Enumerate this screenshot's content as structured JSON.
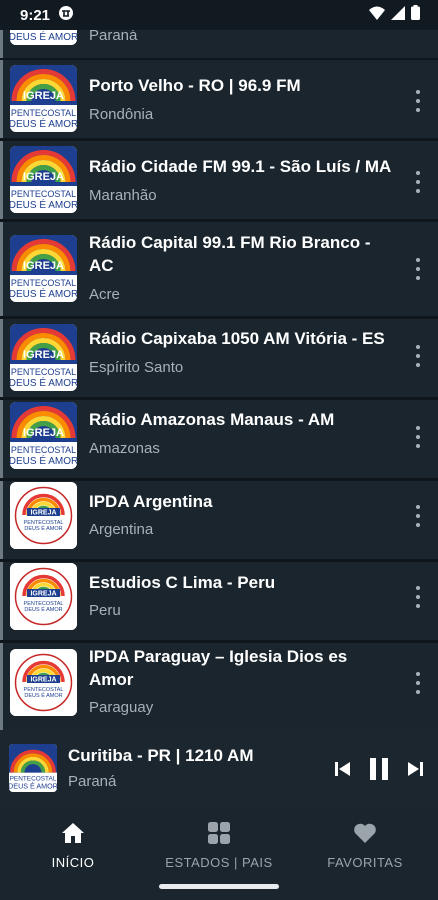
{
  "status_bar": {
    "time": "9:21"
  },
  "logo": {
    "line1": "IGREJA",
    "line2": "PENTECOSTAL",
    "line3": "DEUS É AMOR",
    "alt_line1": "IGREJA"
  },
  "stations": [
    {
      "title": "",
      "subtitle": "Paraná",
      "logo": "ipda-blue"
    },
    {
      "title": "Porto Velho - RO | 96.9 FM",
      "subtitle": "Rondônia",
      "logo": "ipda-blue"
    },
    {
      "title": "Rádio Cidade FM 99.1 - São Luís / MA",
      "subtitle": "Maranhão",
      "logo": "ipda-blue"
    },
    {
      "title": "Rádio Capital 99.1 FM Rio Branco - AC",
      "subtitle": "Acre",
      "logo": "ipda-blue"
    },
    {
      "title": "Rádio Capixaba 1050 AM Vitória - ES",
      "subtitle": "Espírito Santo",
      "logo": "ipda-blue"
    },
    {
      "title": "Rádio Amazonas Manaus - AM",
      "subtitle": "Amazonas",
      "logo": "ipda-blue"
    },
    {
      "title": "IPDA Argentina",
      "subtitle": "Argentina",
      "logo": "ipda-round"
    },
    {
      "title": "Estudios C Lima - Peru",
      "subtitle": "Peru",
      "logo": "ipda-round"
    },
    {
      "title": "IPDA Paraguay – Iglesia Dios es Amor",
      "subtitle": "Paraguay",
      "logo": "ipda-round"
    }
  ],
  "player": {
    "title": "Curitiba - PR | 1210 AM",
    "subtitle": "Paraná",
    "state": "playing"
  },
  "nav": {
    "items": [
      {
        "label": "INÍCIO",
        "icon": "home-icon",
        "active": true
      },
      {
        "label": "ESTADOS | PAIS",
        "icon": "grid-icon",
        "active": false
      },
      {
        "label": "FAVORITAS",
        "icon": "heart-icon",
        "active": false
      }
    ]
  },
  "colors": {
    "background": "#111a21",
    "row": "#1a252d",
    "accent": "#ffffff",
    "muted": "#a7b1b7"
  }
}
